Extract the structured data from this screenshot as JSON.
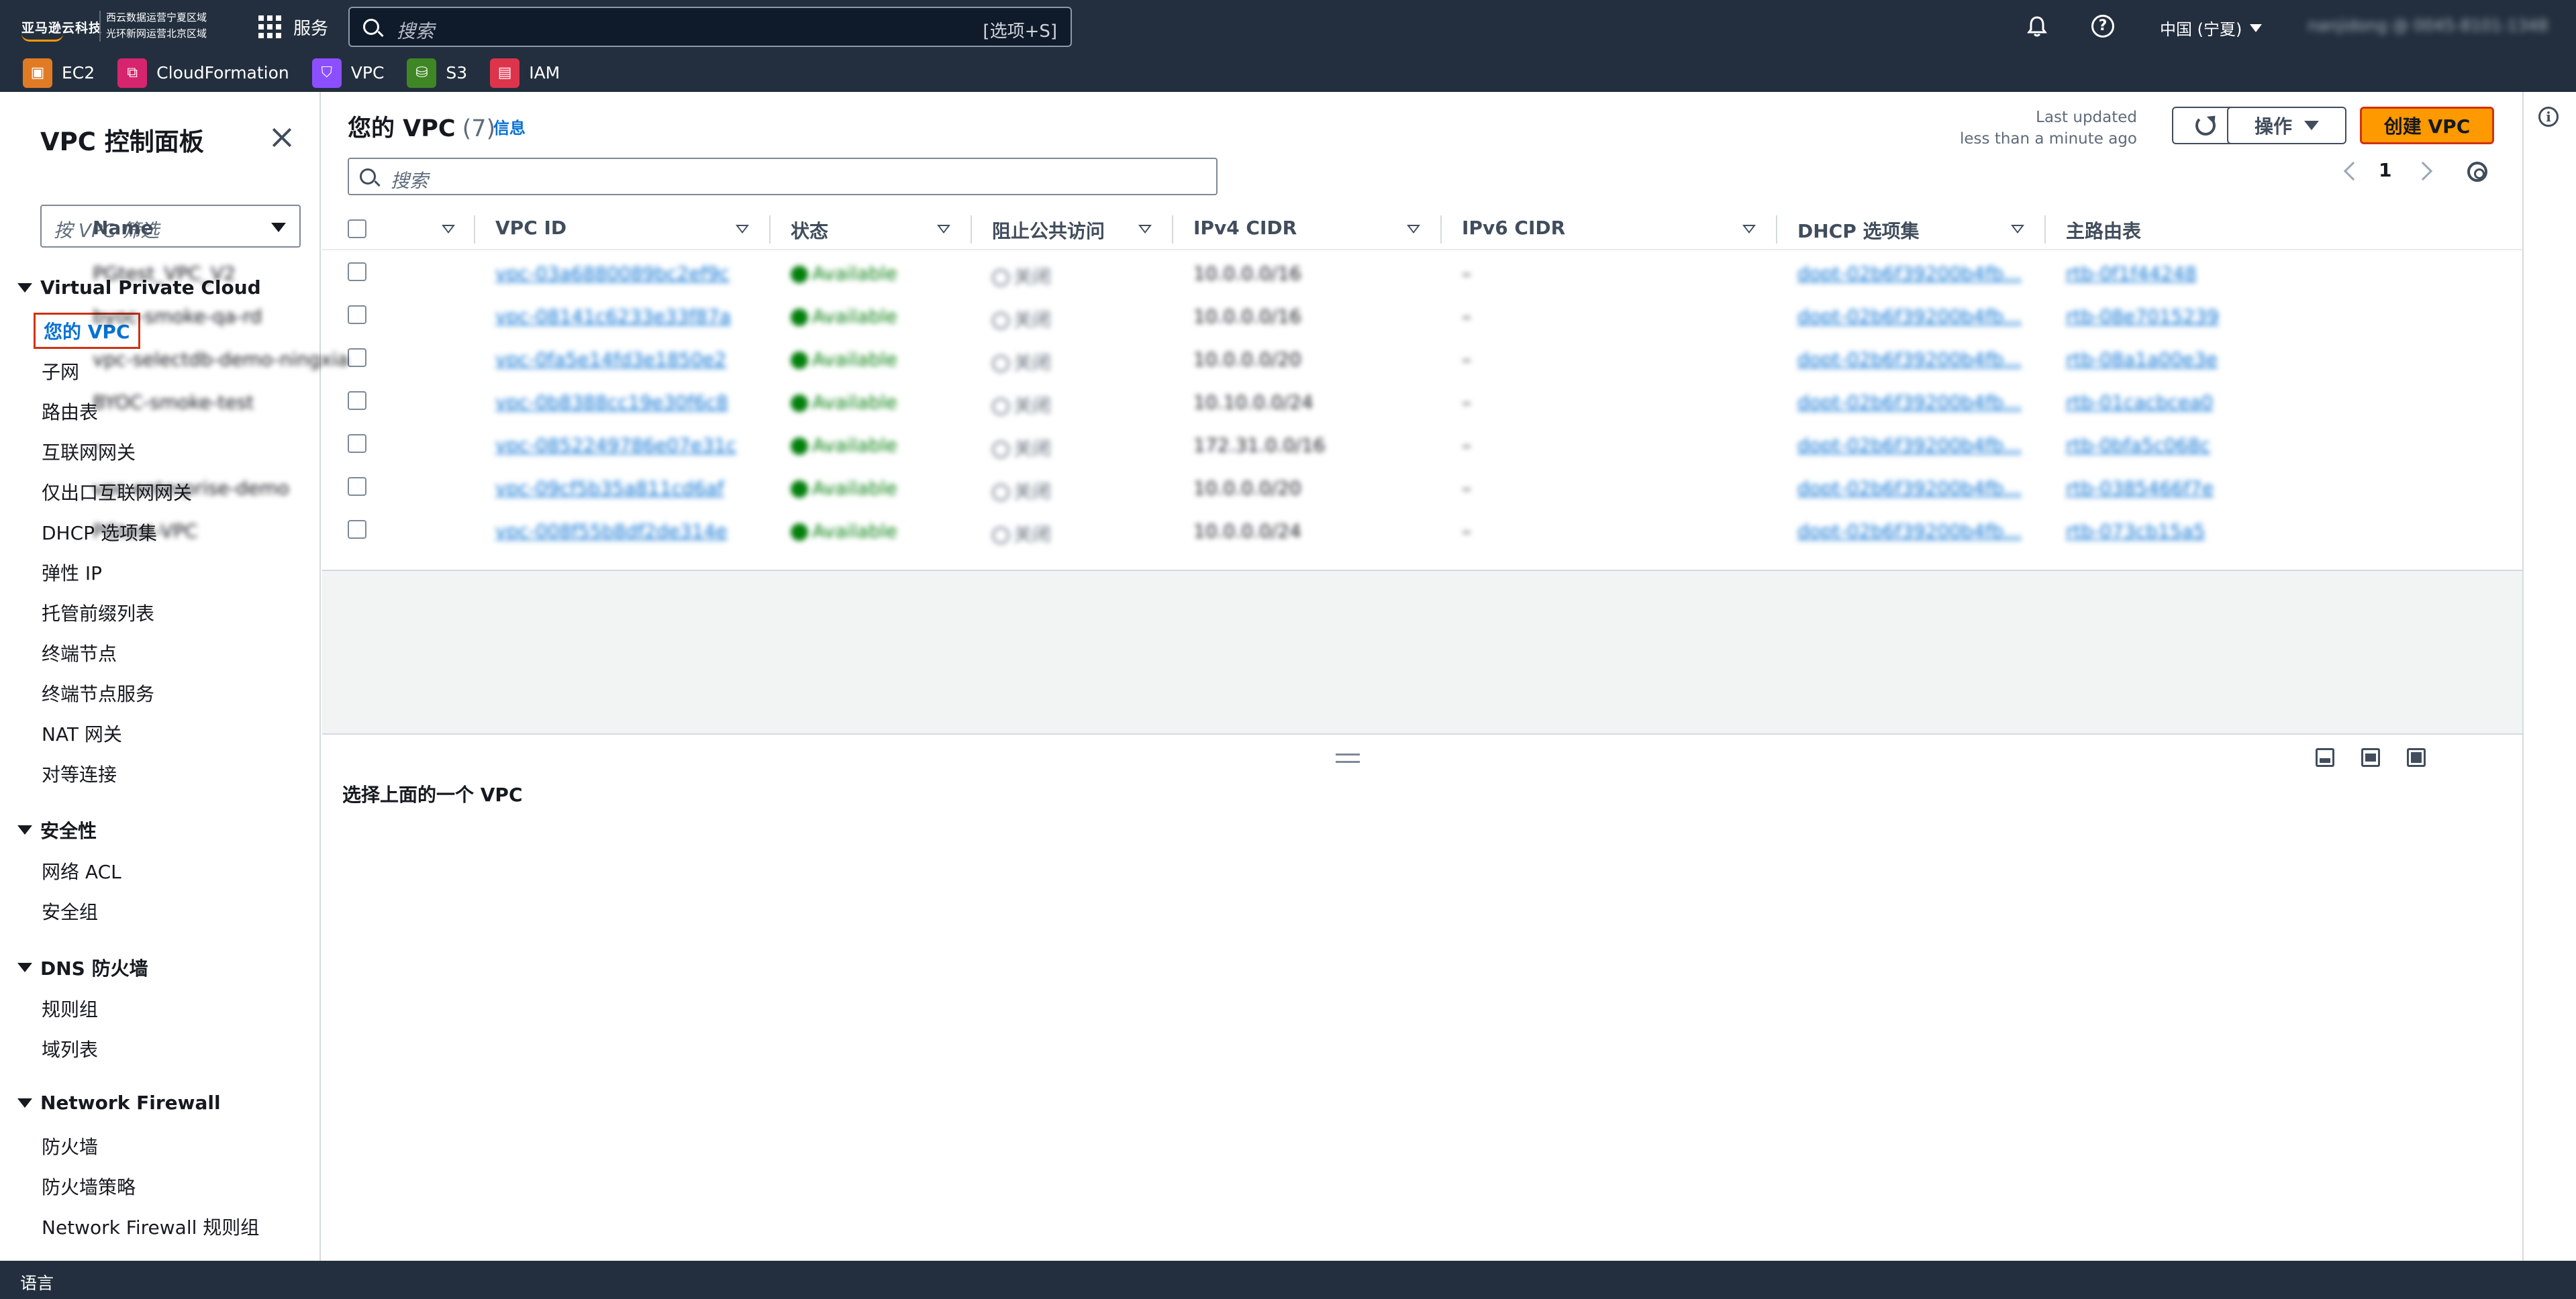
{
  "header": {
    "logo_text": "亚马逊云科技",
    "region_line1": "西云数据运营宁夏区域",
    "region_line2": "光环新网运营北京区域",
    "services_label": "服务",
    "search_placeholder": "搜索",
    "search_shortcut": "[选项+S]",
    "region_selector": "中国 (宁夏)",
    "account_label": "nanjidong @ 0045-8101-1348"
  },
  "favorites": [
    {
      "label": "EC2",
      "color": "#e07b24",
      "glyph": "▣"
    },
    {
      "label": "CloudFormation",
      "color": "#d6246e",
      "glyph": "⧉"
    },
    {
      "label": "VPC",
      "color": "#8c4fff",
      "glyph": "⛉"
    },
    {
      "label": "S3",
      "color": "#3f8624",
      "glyph": "⛁"
    },
    {
      "label": "IAM",
      "color": "#dd344c",
      "glyph": "▤"
    }
  ],
  "sidenav": {
    "title": "VPC 控制面板",
    "filter_placeholder": "按 VPC 筛选",
    "sections": [
      {
        "label": "Virtual Private Cloud",
        "items": [
          "您的 VPC",
          "子网",
          "路由表",
          "互联网网关",
          "仅出口互联网网关",
          "DHCP 选项集",
          "弹性 IP",
          "托管前缀列表",
          "终端节点",
          "终端节点服务",
          "NAT 网关",
          "对等连接"
        ]
      },
      {
        "label": "安全性",
        "items": [
          "网络 ACL",
          "安全组"
        ]
      },
      {
        "label": "DNS 防火墙",
        "items": [
          "规则组",
          "域列表"
        ]
      },
      {
        "label": "Network Firewall",
        "items": [
          "防火墙",
          "防火墙策略",
          "Network Firewall 规则组"
        ]
      }
    ],
    "active_item": "您的 VPC"
  },
  "main": {
    "title": "您的 VPC",
    "count": "(7)",
    "info_link": "信息",
    "last_updated_line1": "Last updated",
    "last_updated_line2": "less than a minute ago",
    "actions_label": "操作",
    "create_label": "创建 VPC",
    "search_placeholder": "搜索",
    "page_number": "1",
    "columns": [
      "Name",
      "VPC ID",
      "状态",
      "阻止公共访问",
      "IPv4 CIDR",
      "IPv6 CIDR",
      "DHCP 选项集",
      "主路由表"
    ],
    "rows": [
      {
        "name": "PGtest_VPC_V2",
        "vpc_id": "vpc-03a6880089bc2ef9c",
        "status": "Available",
        "block": "关闭",
        "ipv4": "10.0.0.0/16",
        "ipv6": "–",
        "dhcp": "dopt-02b6f39200b4fb...",
        "rtb": "rtb-0f1f44248"
      },
      {
        "name": "byoc-smoke-qa-rd",
        "vpc_id": "vpc-08141c6233e33f87a",
        "status": "Available",
        "block": "关闭",
        "ipv4": "10.0.0.0/16",
        "ipv6": "–",
        "dhcp": "dopt-02b6f39200b4fb...",
        "rtb": "rtb-08e7015239"
      },
      {
        "name": "vpc-selectdb-demo-ningxia",
        "vpc_id": "vpc-0fa5e14fd3e1850e2",
        "status": "Available",
        "block": "关闭",
        "ipv4": "10.0.0.0/20",
        "ipv6": "–",
        "dhcp": "dopt-02b6f39200b4fb...",
        "rtb": "rtb-08a1a00e3e"
      },
      {
        "name": "BYOC-smoke-test",
        "vpc_id": "vpc-0b8388cc19e30f6c8",
        "status": "Available",
        "block": "关闭",
        "ipv4": "10.10.0.0/24",
        "ipv6": "–",
        "dhcp": "dopt-02b6f39200b4fb...",
        "rtb": "rtb-01cacbcea0"
      },
      {
        "name": "–",
        "vpc_id": "vpc-0852249786e07e31c",
        "status": "Available",
        "block": "关闭",
        "ipv4": "172.31.0.0/16",
        "ipv6": "–",
        "dhcp": "dopt-02b6f39200b4fb...",
        "rtb": "rtb-0bfa5c068c"
      },
      {
        "name": "vpc-enterprise-demo",
        "vpc_id": "vpc-09cf5b35a811cd6af",
        "status": "Available",
        "block": "关闭",
        "ipv4": "10.0.0.0/20",
        "ipv6": "–",
        "dhcp": "dopt-02b6f39200b4fb...",
        "rtb": "rtb-0385466f7e"
      },
      {
        "name": "PGtest-VPC",
        "vpc_id": "vpc-008f55b8df2de314e",
        "status": "Available",
        "block": "关闭",
        "ipv4": "10.0.0.0/24",
        "ipv6": "–",
        "dhcp": "dopt-02b6f39200b4fb...",
        "rtb": "rtb-073cb15a5"
      }
    ],
    "detail_placeholder": "选择上面的一个 VPC"
  },
  "footer": {
    "language_label": "语言"
  }
}
